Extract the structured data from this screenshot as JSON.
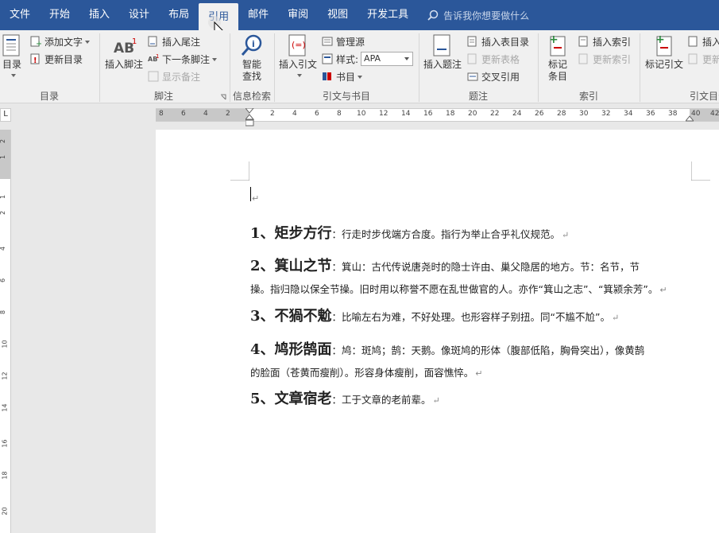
{
  "tabs": [
    "文件",
    "开始",
    "插入",
    "设计",
    "布局",
    "引用",
    "邮件",
    "审阅",
    "视图",
    "开发工具"
  ],
  "active_tab": "引用",
  "search_placeholder": "告诉我你想要做什么",
  "ribbon": {
    "toc": {
      "btn": "目录",
      "add_text": "添加文字",
      "update": "更新目录",
      "label": "目录"
    },
    "footnotes": {
      "insert": "插入脚注",
      "endnote": "插入尾注",
      "next": "下一条脚注",
      "show": "显示备注",
      "label": "脚注"
    },
    "research": {
      "smart": "智能",
      "smart2": "查找",
      "label": "信息检索"
    },
    "citations": {
      "insert": "插入引文",
      "manage": "管理源",
      "style_label": "样式:",
      "style_value": "APA",
      "bib": "书目",
      "label": "引文与书目"
    },
    "captions": {
      "insert": "插入题注",
      "table_figures": "插入表目录",
      "update_table": "更新表格",
      "cross_ref": "交叉引用",
      "label": "题注"
    },
    "index": {
      "mark": "标记",
      "mark2": "条目",
      "insert": "插入索引",
      "update": "更新索引",
      "label": "索引"
    },
    "toa": {
      "mark": "标记引文",
      "insert": "插入",
      "update": "更新",
      "label": "引文目录"
    }
  },
  "ruler_numbers": [
    "8",
    "6",
    "4",
    "2",
    "2",
    "4",
    "6",
    "8",
    "10",
    "12",
    "14",
    "16",
    "18",
    "20",
    "22",
    "24",
    "26",
    "28",
    "30",
    "32",
    "34",
    "36",
    "38",
    "40",
    "42"
  ],
  "vruler_numbers": [
    "2",
    "1",
    "1",
    "2",
    "4",
    "6",
    "8",
    "10",
    "12",
    "14",
    "16",
    "18",
    "20"
  ],
  "doc": {
    "p1": {
      "head": "1、矩步方行",
      "body": "：行走时步伐端方合度。指行为举止合乎礼仪规范。"
    },
    "p2": {
      "head": "2、箕山之节",
      "body": "：箕山：古代传说唐尧时的隐士许由、巢父隐居的地方。节：名节，节",
      "body2": "操。指归隐以保全节操。旧时用以称誉不愿在乱世做官的人。亦作“箕山之志”、“箕颍余芳”。"
    },
    "p3": {
      "head": "3、不猧不魀",
      "body": "：比喻左右为难，不好处理。也形容样子别扭。同“不尴不尬”。"
    },
    "p4": {
      "head": "4、鸠形鹄面",
      "body": "：鸠：斑鸠；鹄：天鹅。像斑鸠的形体（腹部低陷，胸骨突出），像黄鹄",
      "body2": "的脸面（苍黄而瘦削）。形容身体瘦削，面容憔悴。"
    },
    "p5": {
      "head": "5、文章宿老",
      "body": "：工于文章的老前辈。"
    },
    "para_mark": "↵"
  },
  "colors": {
    "accent": "#2b579a"
  }
}
